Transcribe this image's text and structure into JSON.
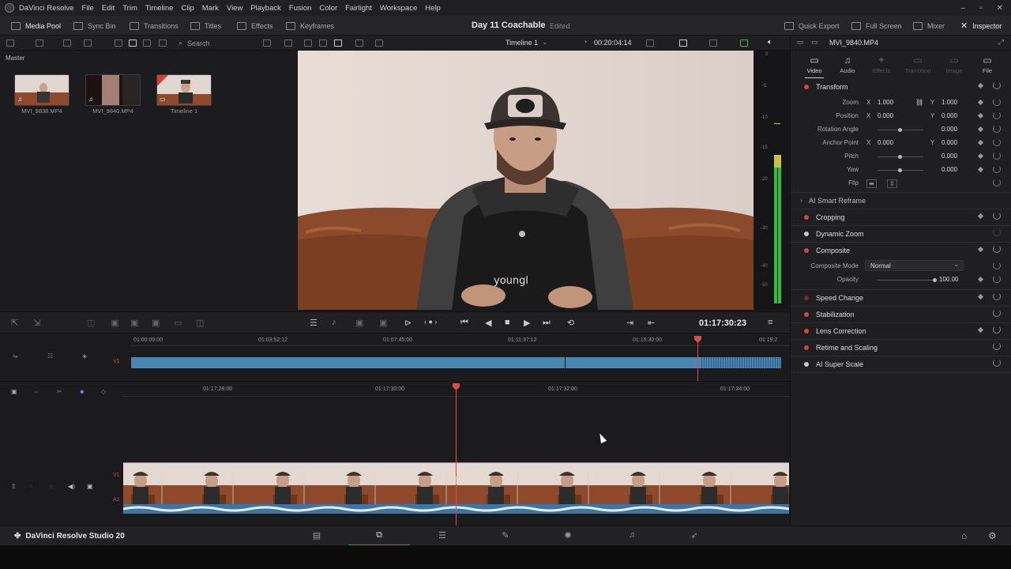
{
  "menu": {
    "app_name": "DaVinci Resolve",
    "items": [
      "File",
      "Edit",
      "Trim",
      "Timeline",
      "Clip",
      "Mark",
      "View",
      "Playback",
      "Fusion",
      "Color",
      "Fairlight",
      "Workspace",
      "Help"
    ]
  },
  "toolbar": {
    "media_pool": "Media Pool",
    "sync_bin": "Sync Bin",
    "transitions": "Transitions",
    "titles": "Titles",
    "effects": "Effects",
    "keyframes": "Keyframes",
    "project_title": "Day 11 Coachable",
    "project_status": "Edited",
    "quick_export": "Quick Export",
    "full_screen": "Full Screen",
    "mixer": "Mixer",
    "inspector": "Inspector"
  },
  "subbar": {
    "search_placeholder": "Search",
    "timeline_name": "Timeline 1",
    "timecode": "00:20:04:14",
    "clip_name": "MVI_9840.MP4"
  },
  "media_pool": {
    "bin": "Master",
    "clips": [
      {
        "name": "MVI_9838.MP4"
      },
      {
        "name": "MVI_9840.MP4"
      },
      {
        "name": "Timeline 1"
      }
    ]
  },
  "viewer": {
    "hoodie_text": "youngl"
  },
  "vu_meter": {
    "ticks": [
      "0",
      "-5",
      "-10",
      "-15",
      "-20",
      "-30",
      "-40",
      "-50"
    ]
  },
  "transport": {
    "timecode": "01:17:30:23"
  },
  "upper_timeline": {
    "ticks": [
      "01:00:00:00",
      "01:03:52:12",
      "01:07:45:00",
      "01:11:37:12",
      "01:15:30:00",
      "01:19:2"
    ],
    "track_label": "V1"
  },
  "lower_timeline": {
    "ticks": [
      "01:17:28:00",
      "01:17:30:00",
      "01:17:32:00",
      "01:17:34:00"
    ],
    "video_track_label": "V1",
    "audio_track_label": "A1"
  },
  "inspector": {
    "tabs": [
      {
        "label": "Video",
        "glyph": "▭"
      },
      {
        "label": "Audio",
        "glyph": "♫"
      },
      {
        "label": "Effects",
        "glyph": "✦"
      },
      {
        "label": "Transition",
        "glyph": "▭"
      },
      {
        "label": "Image",
        "glyph": "▭"
      },
      {
        "label": "File",
        "glyph": "▭"
      }
    ],
    "transform": {
      "title": "Transform",
      "zoom_label": "Zoom",
      "zoom_x": "1.000",
      "zoom_y": "1.000",
      "position_label": "Position",
      "position_x": "0.000",
      "position_y": "0.000",
      "rotation_label": "Rotation Angle",
      "rotation": "0.000",
      "anchor_label": "Anchor Point",
      "anchor_x": "0.000",
      "anchor_y": "0.000",
      "pitch_label": "Pitch",
      "pitch": "0.000",
      "yaw_label": "Yaw",
      "yaw": "0.000",
      "flip_label": "Flip",
      "x_axis": "X",
      "y_axis": "Y"
    },
    "smart_reframe": "AI Smart Reframe",
    "cropping": "Cropping",
    "dynamic_zoom": "Dynamic Zoom",
    "composite": {
      "title": "Composite",
      "mode_label": "Composite Mode",
      "mode_value": "Normal",
      "opacity_label": "Opacity",
      "opacity_value": "100.00"
    },
    "speed_change": "Speed Change",
    "stabilization": "Stabilization",
    "lens_correction": "Lens Correction",
    "retime_scaling": "Retime and Scaling",
    "super_scale": "AI Super Scale"
  },
  "page_nav": {
    "brand": "DaVinci Resolve Studio 20"
  },
  "colors": {
    "accent_red": "#e14a4a",
    "clip_blue": "#4a86b3",
    "panel_bg": "#1f1f22"
  }
}
